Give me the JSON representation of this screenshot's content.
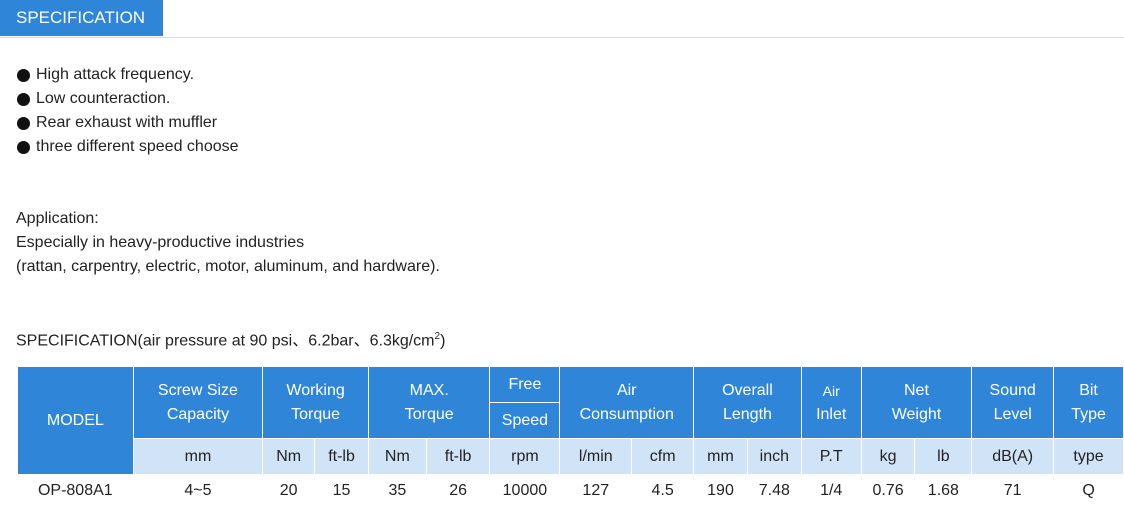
{
  "tab": {
    "label": "SPECIFICATION"
  },
  "features": [
    "High attack frequency.",
    "Low counteraction.",
    "Rear exhaust with muffler",
    "three different speed choose"
  ],
  "application": {
    "title": "Application:",
    "line1": "Especially in heavy-productive industries",
    "line2": "(rattan, carpentry, electric, motor, aluminum, and hardware)."
  },
  "spec_heading": {
    "text": "SPECIFICATION(air pressure at 90 psi、6.2bar、6.3kg/cm",
    "sup": "2",
    "close": ")"
  },
  "table": {
    "headers": {
      "model": "MODEL",
      "screw_size_1": "Screw Size",
      "screw_size_2": "Capacity",
      "working_torque_1": "Working",
      "working_torque_2": "Torque",
      "max_torque_1": "MAX.",
      "max_torque_2": "Torque",
      "free_1": "Free",
      "free_2": "Speed",
      "air_consumption_1": "Air",
      "air_consumption_2": "Consumption",
      "overall_length_1": "Overall",
      "overall_length_2": "Length",
      "air_inlet_1": "Air",
      "air_inlet_2": "Inlet",
      "net_weight_1": "Net",
      "net_weight_2": "Weight",
      "sound_level_1": "Sound",
      "sound_level_2": "Level",
      "bit_type_1": "Bit",
      "bit_type_2": "Type"
    },
    "units": [
      "mm",
      "Nm",
      "ft-lb",
      "Nm",
      "ft-lb",
      "rpm",
      "l/min",
      "cfm",
      "mm",
      "inch",
      "P.T",
      "kg",
      "lb",
      "dB(A)",
      "type"
    ],
    "row": [
      "OP-808A1",
      "4~5",
      "20",
      "15",
      "35",
      "26",
      "10000",
      "127",
      "4.5",
      "190",
      "7.48",
      "1/4",
      "0.76",
      "1.68",
      "71",
      "Q"
    ],
    "colors": {
      "header": "#2f86d8",
      "unit_row": "#d1e4f7",
      "bit_type_value": "#e02020"
    }
  }
}
